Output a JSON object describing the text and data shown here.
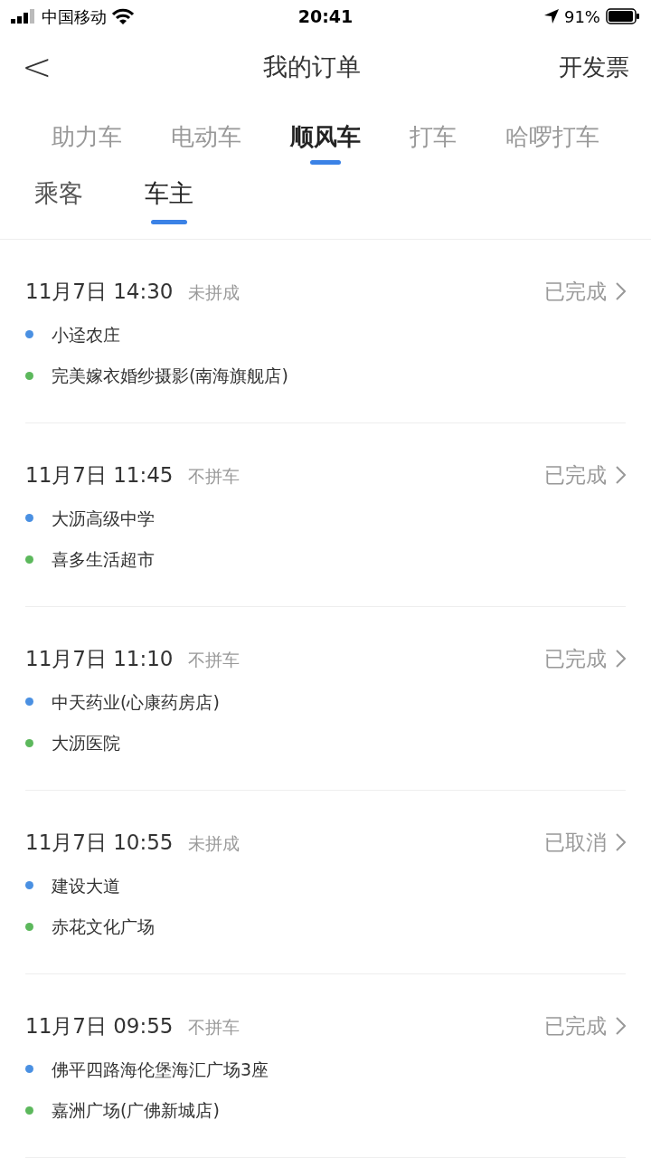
{
  "status_bar": {
    "carrier": "中国移动",
    "time": "20:41",
    "battery": "91%"
  },
  "header": {
    "back": "<",
    "title": "我的订单",
    "action": "开发票"
  },
  "tabs": [
    {
      "label": "助力车",
      "selected": false
    },
    {
      "label": "电动车",
      "selected": false
    },
    {
      "label": "顺风车",
      "selected": true
    },
    {
      "label": "打车",
      "selected": false
    },
    {
      "label": "哈啰打车",
      "selected": false
    }
  ],
  "sub_tabs": [
    {
      "label": "乘客",
      "selected": false
    },
    {
      "label": "车主",
      "selected": true
    }
  ],
  "orders": [
    {
      "time": "11月7日 14:30",
      "type": "未拼成",
      "status": "已完成",
      "from": "小迳农庄",
      "to": "完美嫁衣婚纱摄影(南海旗舰店)"
    },
    {
      "time": "11月7日 11:45",
      "type": "不拼车",
      "status": "已完成",
      "from": "大沥高级中学",
      "to": "喜多生活超市"
    },
    {
      "time": "11月7日 11:10",
      "type": "不拼车",
      "status": "已完成",
      "from": "中天药业(心康药房店)",
      "to": "大沥医院"
    },
    {
      "time": "11月7日 10:55",
      "type": "未拼成",
      "status": "已取消",
      "from": "建设大道",
      "to": "赤花文化广场"
    },
    {
      "time": "11月7日 09:55",
      "type": "不拼车",
      "status": "已完成",
      "from": "佛平四路海伦堡海汇广场3座",
      "to": "嘉洲广场(广佛新城店)"
    }
  ]
}
